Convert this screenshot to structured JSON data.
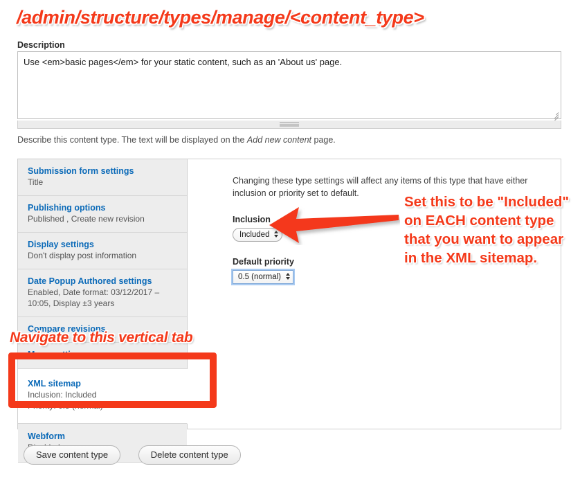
{
  "annotations": {
    "path_title": "/admin/structure/types/manage/<content_type>",
    "arrow_note": "Set this to be \"Included\" on EACH content type that you want to appear in the XML sitemap.",
    "navigate_note": "Navigate to this vertical tab",
    "accent_color": "#f4391a"
  },
  "description_field": {
    "label": "Description",
    "value": "Use <em>basic pages</em> for your static content, such as an 'About us' page.",
    "help_before": "Describe this content type. The text will be displayed on the ",
    "help_emphasis": "Add new content",
    "help_after": " page."
  },
  "vertical_tabs": [
    {
      "title": "Submission form settings",
      "summary": "Title",
      "selected": false
    },
    {
      "title": "Publishing options",
      "summary": "Published , Create new revision",
      "selected": false
    },
    {
      "title": "Display settings",
      "summary": "Don't display post information",
      "selected": false
    },
    {
      "title": "Date Popup Authored settings",
      "summary": "Enabled, Date format: 03/12/2017 – 10:05, Display ±3 years",
      "selected": false
    },
    {
      "title": "Compare revisions",
      "summary": "",
      "selected": false
    },
    {
      "title": "Menu settings",
      "summary": "",
      "selected": false
    },
    {
      "title": "XML sitemap",
      "summary": "Inclusion: Included\nPriority: 0.5 (normal)",
      "selected": true
    },
    {
      "title": "Webform",
      "summary": "Disabled",
      "selected": false
    }
  ],
  "pane": {
    "intro": "Changing these type settings will affect any items of this type that have either inclusion or priority set to default.",
    "inclusion": {
      "label": "Inclusion",
      "value": "Included"
    },
    "priority": {
      "label": "Default priority",
      "value": "0.5 (normal)"
    }
  },
  "actions": {
    "save_label": "Save content type",
    "delete_label": "Delete content type"
  }
}
